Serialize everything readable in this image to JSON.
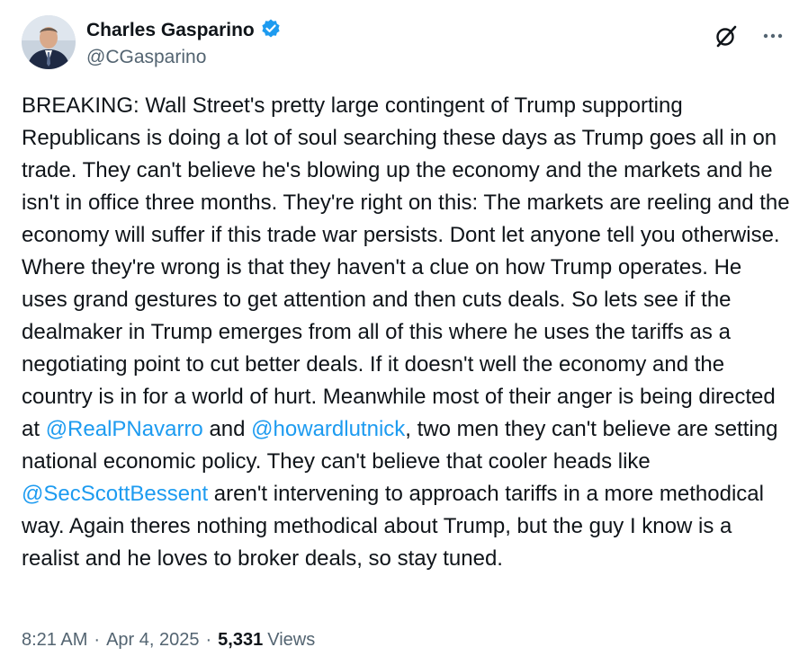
{
  "author": {
    "display_name": "Charles Gasparino",
    "handle": "@CGasparino",
    "verified": true
  },
  "actions": {
    "grok_icon": "grok-slash-icon",
    "more_icon": "more-horizontal-icon"
  },
  "tweet": {
    "text_1": "BREAKING: Wall Street's pretty large contingent of Trump supporting Republicans is doing a lot of soul searching these days as Trump goes all in on trade. They can't believe he's blowing up the economy and the markets and he isn't in office three months. They're right on this: The markets are reeling and the economy will suffer if this trade war persists. Dont let anyone tell you otherwise. Where they're wrong is that they haven't a clue on how Trump operates. He uses grand gestures to get attention and then cuts deals. So lets see if the dealmaker in Trump emerges from all of this where he uses the tariffs as a negotiating point to cut better deals. If it doesn't well the economy and the country is in for a world of hurt. Meanwhile most of their anger is being directed at ",
    "mention_1": "@RealPNavarro",
    "text_2": " and ",
    "mention_2": "@howardlutnick",
    "text_3": ", two men they can't believe are setting national economic policy. They can't believe that cooler heads like ",
    "mention_3": "@SecScottBessent",
    "text_4": " aren't intervening to approach tariffs in a more methodical way. Again theres nothing methodical about Trump, but the guy I know is a realist and he loves to broker deals, so stay tuned."
  },
  "meta": {
    "time": "8:21 AM",
    "separator": "·",
    "date": "Apr 4, 2025",
    "views_count": "5,331",
    "views_label": "Views"
  },
  "colors": {
    "link": "#1d9bf0",
    "verified_badge": "#1d9bf0",
    "secondary_text": "#536471",
    "primary_text": "#0f1419"
  }
}
